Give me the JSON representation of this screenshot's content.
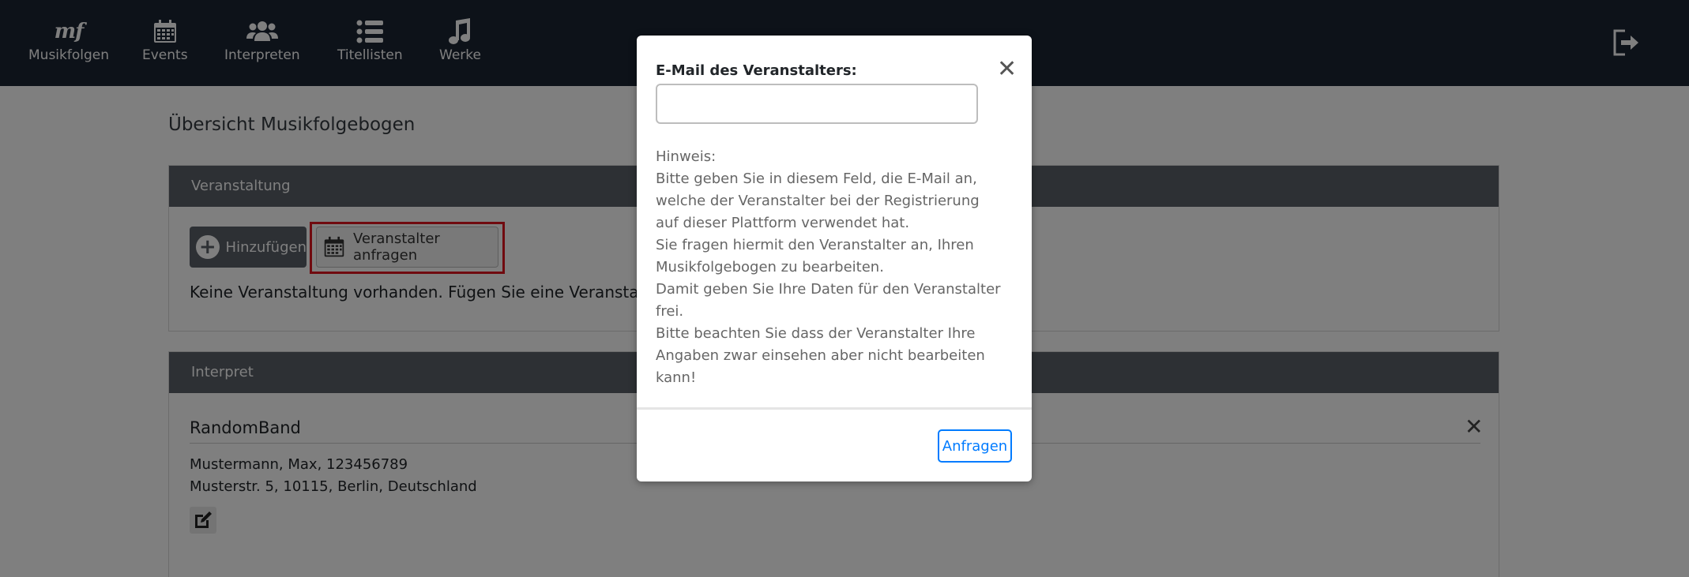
{
  "nav": {
    "items": [
      {
        "label": "Musikfolgen",
        "icon": "mf-logo-icon",
        "logo_text": "mf"
      },
      {
        "label": "Events",
        "icon": "calendar-icon"
      },
      {
        "label": "Interpreten",
        "icon": "users-icon"
      },
      {
        "label": "Titellisten",
        "icon": "list-icon"
      },
      {
        "label": "Werke",
        "icon": "music-note-icon"
      }
    ],
    "logout_icon": "logout-icon"
  },
  "page": {
    "title": "Übersicht Musikfolgebogen",
    "veranstaltung": {
      "header": "Veranstaltung",
      "add_button": "Hinzufügen",
      "request_button": "Veranstalter anfragen",
      "empty_text": "Keine Veranstaltung vorhanden. Fügen Sie eine Veranstaltung"
    },
    "interpret": {
      "header": "Interpret",
      "name": "RandomBand",
      "line1": "Mustermann, Max, 123456789",
      "line2": "Musterstr. 5, 10115, Berlin, Deutschland"
    }
  },
  "modal": {
    "label": "E-Mail des Veranstalters:",
    "input_value": "",
    "hint_lines": [
      "Hinweis:",
      "Bitte geben Sie in diesem Feld, die E-Mail an,",
      "welche der Veranstalter bei der Registrierung",
      "auf dieser Plattform verwendet hat.",
      "Sie fragen hiermit den Veranstalter an, Ihren",
      "Musikfolgebogen zu bearbeiten.",
      "Damit geben Sie Ihre Daten für den Veranstalter",
      "frei.",
      "Bitte beachten Sie dass der Veranstalter Ihre",
      "Angaben zwar einsehen aber nicht bearbeiten",
      "kann!"
    ],
    "submit": "Anfragen"
  },
  "colors": {
    "navbar": "#1a2433",
    "card_header": "#5a6069",
    "highlight": "#e0141e",
    "primary": "#007bff"
  }
}
